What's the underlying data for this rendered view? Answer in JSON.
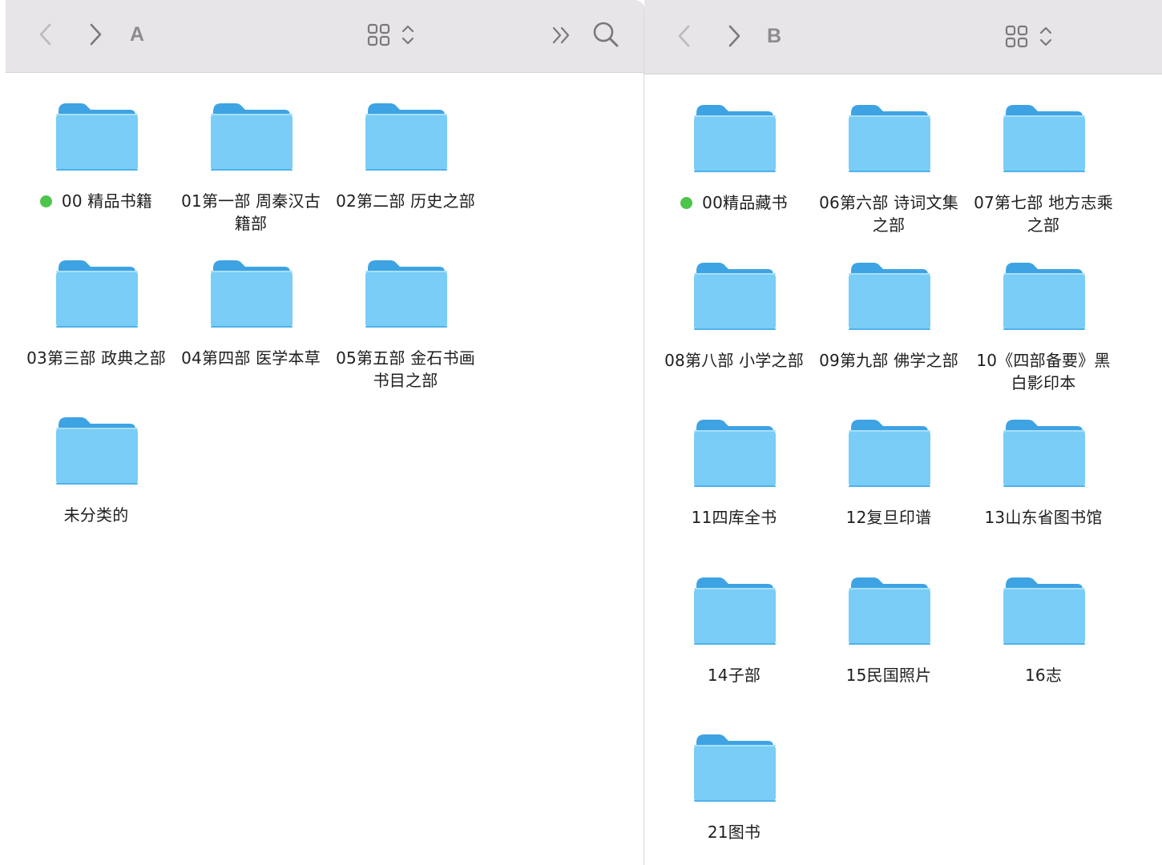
{
  "window_a": {
    "title": "A",
    "items": [
      {
        "label": "00 精品书籍",
        "tag": "green"
      },
      {
        "label": "01第一部 周秦汉古籍部"
      },
      {
        "label": "02第二部 历史之部"
      },
      {
        "label": "03第三部 政典之部"
      },
      {
        "label": "04第四部 医学本草"
      },
      {
        "label": "05第五部 金石书画书目之部"
      },
      {
        "label": "未分类的"
      }
    ]
  },
  "window_b": {
    "title": "B",
    "items": [
      {
        "label": "00精品藏书",
        "tag": "green"
      },
      {
        "label": "06第六部 诗词文集之部"
      },
      {
        "label": "07第七部 地方志乘之部"
      },
      {
        "label": "08第八部 小学之部"
      },
      {
        "label": "09第九部 佛学之部"
      },
      {
        "label": "10《四部备要》黑白影印本"
      },
      {
        "label": "11四库全书"
      },
      {
        "label": "12复旦印谱"
      },
      {
        "label": "13山东省图书馆"
      },
      {
        "label": "14子部"
      },
      {
        "label": "15民国照片"
      },
      {
        "label": "16志"
      },
      {
        "label": "21图书"
      }
    ]
  },
  "icons": {
    "back": "chevron-left-icon",
    "forward": "chevron-right-icon",
    "view": "icon-grid-view-icon",
    "more": "double-chevron-right-icon",
    "search": "search-icon",
    "folder": "folder-icon"
  },
  "colors": {
    "folder_front": "#79cdf6",
    "folder_back": "#3ea3e3",
    "tag_green": "#4cc54a",
    "toolbar": "#e8e5e8"
  }
}
